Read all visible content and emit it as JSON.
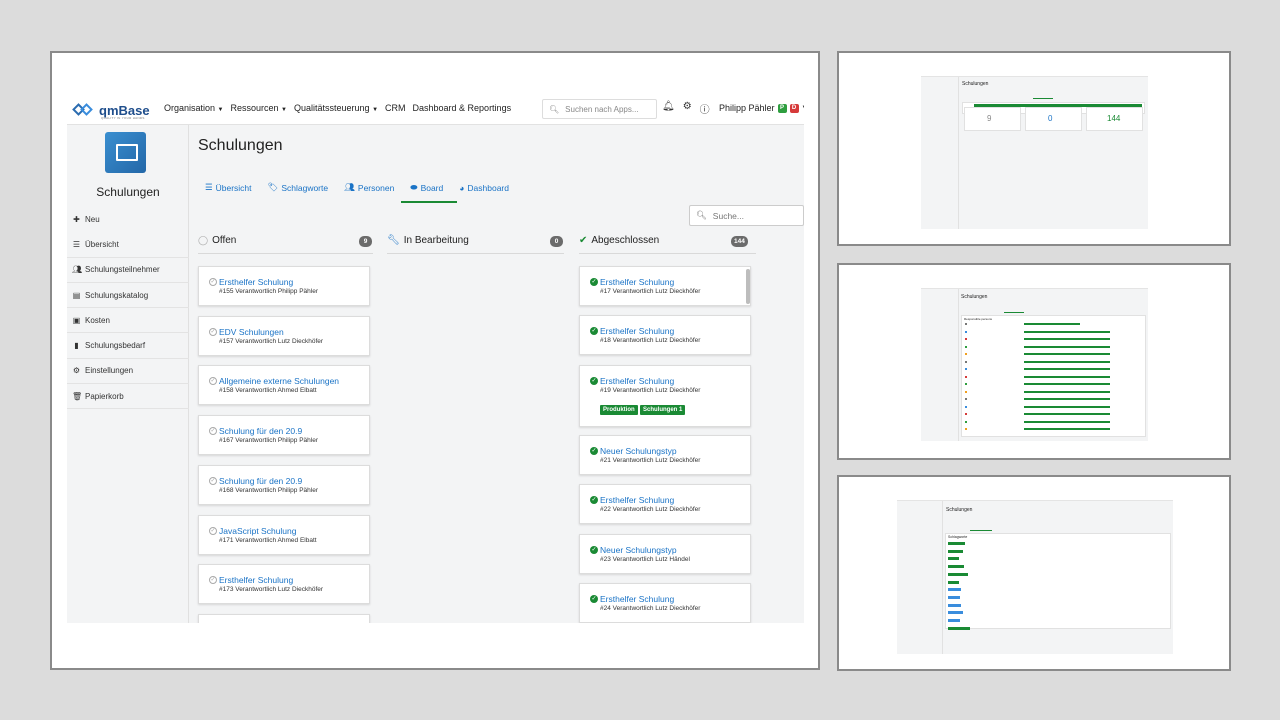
{
  "nav": {
    "logo_text": "qmBase",
    "logo_tagline": "QUALITY IN YOUR HANDS",
    "menu": [
      "Organisation",
      "Ressourcen",
      "Qualitätssteuerung",
      "CRM",
      "Dashboard & Reportings"
    ],
    "search_placeholder": "Suchen nach Apps...",
    "user_name": "Philipp Pähler",
    "badges": [
      {
        "text": "P",
        "color": "#2e9e3f"
      },
      {
        "text": "D",
        "color": "#d63a3a"
      }
    ]
  },
  "sidebar": {
    "title": "Schulungen",
    "items": [
      {
        "label": "Neu",
        "icon": "plus-icon"
      },
      {
        "label": "Übersicht",
        "icon": "list-icon"
      },
      {
        "label": "Schulungsteilnehmer",
        "icon": "users-icon"
      },
      {
        "label": "Schulungskatalog",
        "icon": "catalog-icon"
      },
      {
        "label": "Kosten",
        "icon": "money-icon"
      },
      {
        "label": "Schulungsbedarf",
        "icon": "document-icon"
      },
      {
        "label": "Einstellungen",
        "icon": "gear-icon"
      },
      {
        "label": "Papierkorb",
        "icon": "trash-icon"
      }
    ]
  },
  "page": {
    "title": "Schulungen",
    "tabs": [
      {
        "label": "Übersicht",
        "icon": "list-icon"
      },
      {
        "label": "Schlagworte",
        "icon": "tags-icon"
      },
      {
        "label": "Personen",
        "icon": "users-icon"
      },
      {
        "label": "Board",
        "icon": "board-icon",
        "active": true
      },
      {
        "label": "Dashboard",
        "icon": "pie-icon"
      }
    ],
    "board_search_placeholder": "Suche..."
  },
  "columns": [
    {
      "title": "Offen",
      "count": "9",
      "icon": "circle-check-outline-icon"
    },
    {
      "title": "In Bearbeitung",
      "count": "0",
      "icon": "wrench-icon"
    },
    {
      "title": "Abgeschlossen",
      "count": "144",
      "icon": "check-circle-icon"
    }
  ],
  "cards_open": [
    {
      "title": "Ersthelfer Schulung",
      "sub": "#155 Verantwortlich Philipp Pähler"
    },
    {
      "title": "EDV Schulungen",
      "sub": "#157 Verantwortlich Lutz Dieckhöfer"
    },
    {
      "title": "Allgemeine externe Schulungen",
      "sub": "#158 Verantwortlich Ahmed Elbatt"
    },
    {
      "title": "Schulung für den 20.9",
      "sub": "#167 Verantwortlich Philipp Pähler"
    },
    {
      "title": "Schulung für den 20.9",
      "sub": "#168 Verantwortlich Philipp Pähler"
    },
    {
      "title": "JavaScript Schulung",
      "sub": "#171 Verantwortlich Ahmed Elbatt"
    },
    {
      "title": "Ersthelfer Schulung",
      "sub": "#173 Verantwortlich Lutz Dieckhöfer"
    }
  ],
  "cards_done": [
    {
      "title": "Ersthelfer Schulung",
      "sub": "#17 Verantwortlich Lutz Dieckhöfer"
    },
    {
      "title": "Ersthelfer Schulung",
      "sub": "#18 Verantwortlich Lutz Dieckhöfer"
    },
    {
      "title": "Ersthelfer Schulung",
      "sub": "#19 Verantwortlich Lutz Dieckhöfer",
      "tags": [
        "Produktion",
        "Schulungen 1"
      ]
    },
    {
      "title": "Neuer Schulungstyp",
      "sub": "#21 Verantwortlich Lutz Dieckhöfer"
    },
    {
      "title": "Ersthelfer Schulung",
      "sub": "#22 Verantwortlich Lutz Dieckhöfer"
    },
    {
      "title": "Neuer Schulungstyp",
      "sub": "#23 Verantwortlich Lutz Händel"
    },
    {
      "title": "Ersthelfer Schulung",
      "sub": "#24 Verantwortlich Lutz Dieckhöfer"
    }
  ],
  "thumb_dashboard": {
    "title": "Schulungen",
    "stats": [
      "9",
      "0",
      "144"
    ]
  },
  "thumb_persons": {
    "title": "Schulungen",
    "heading": "Responsible persons"
  },
  "thumb_tags": {
    "title": "Schulungen",
    "heading": "Schlagworte"
  }
}
